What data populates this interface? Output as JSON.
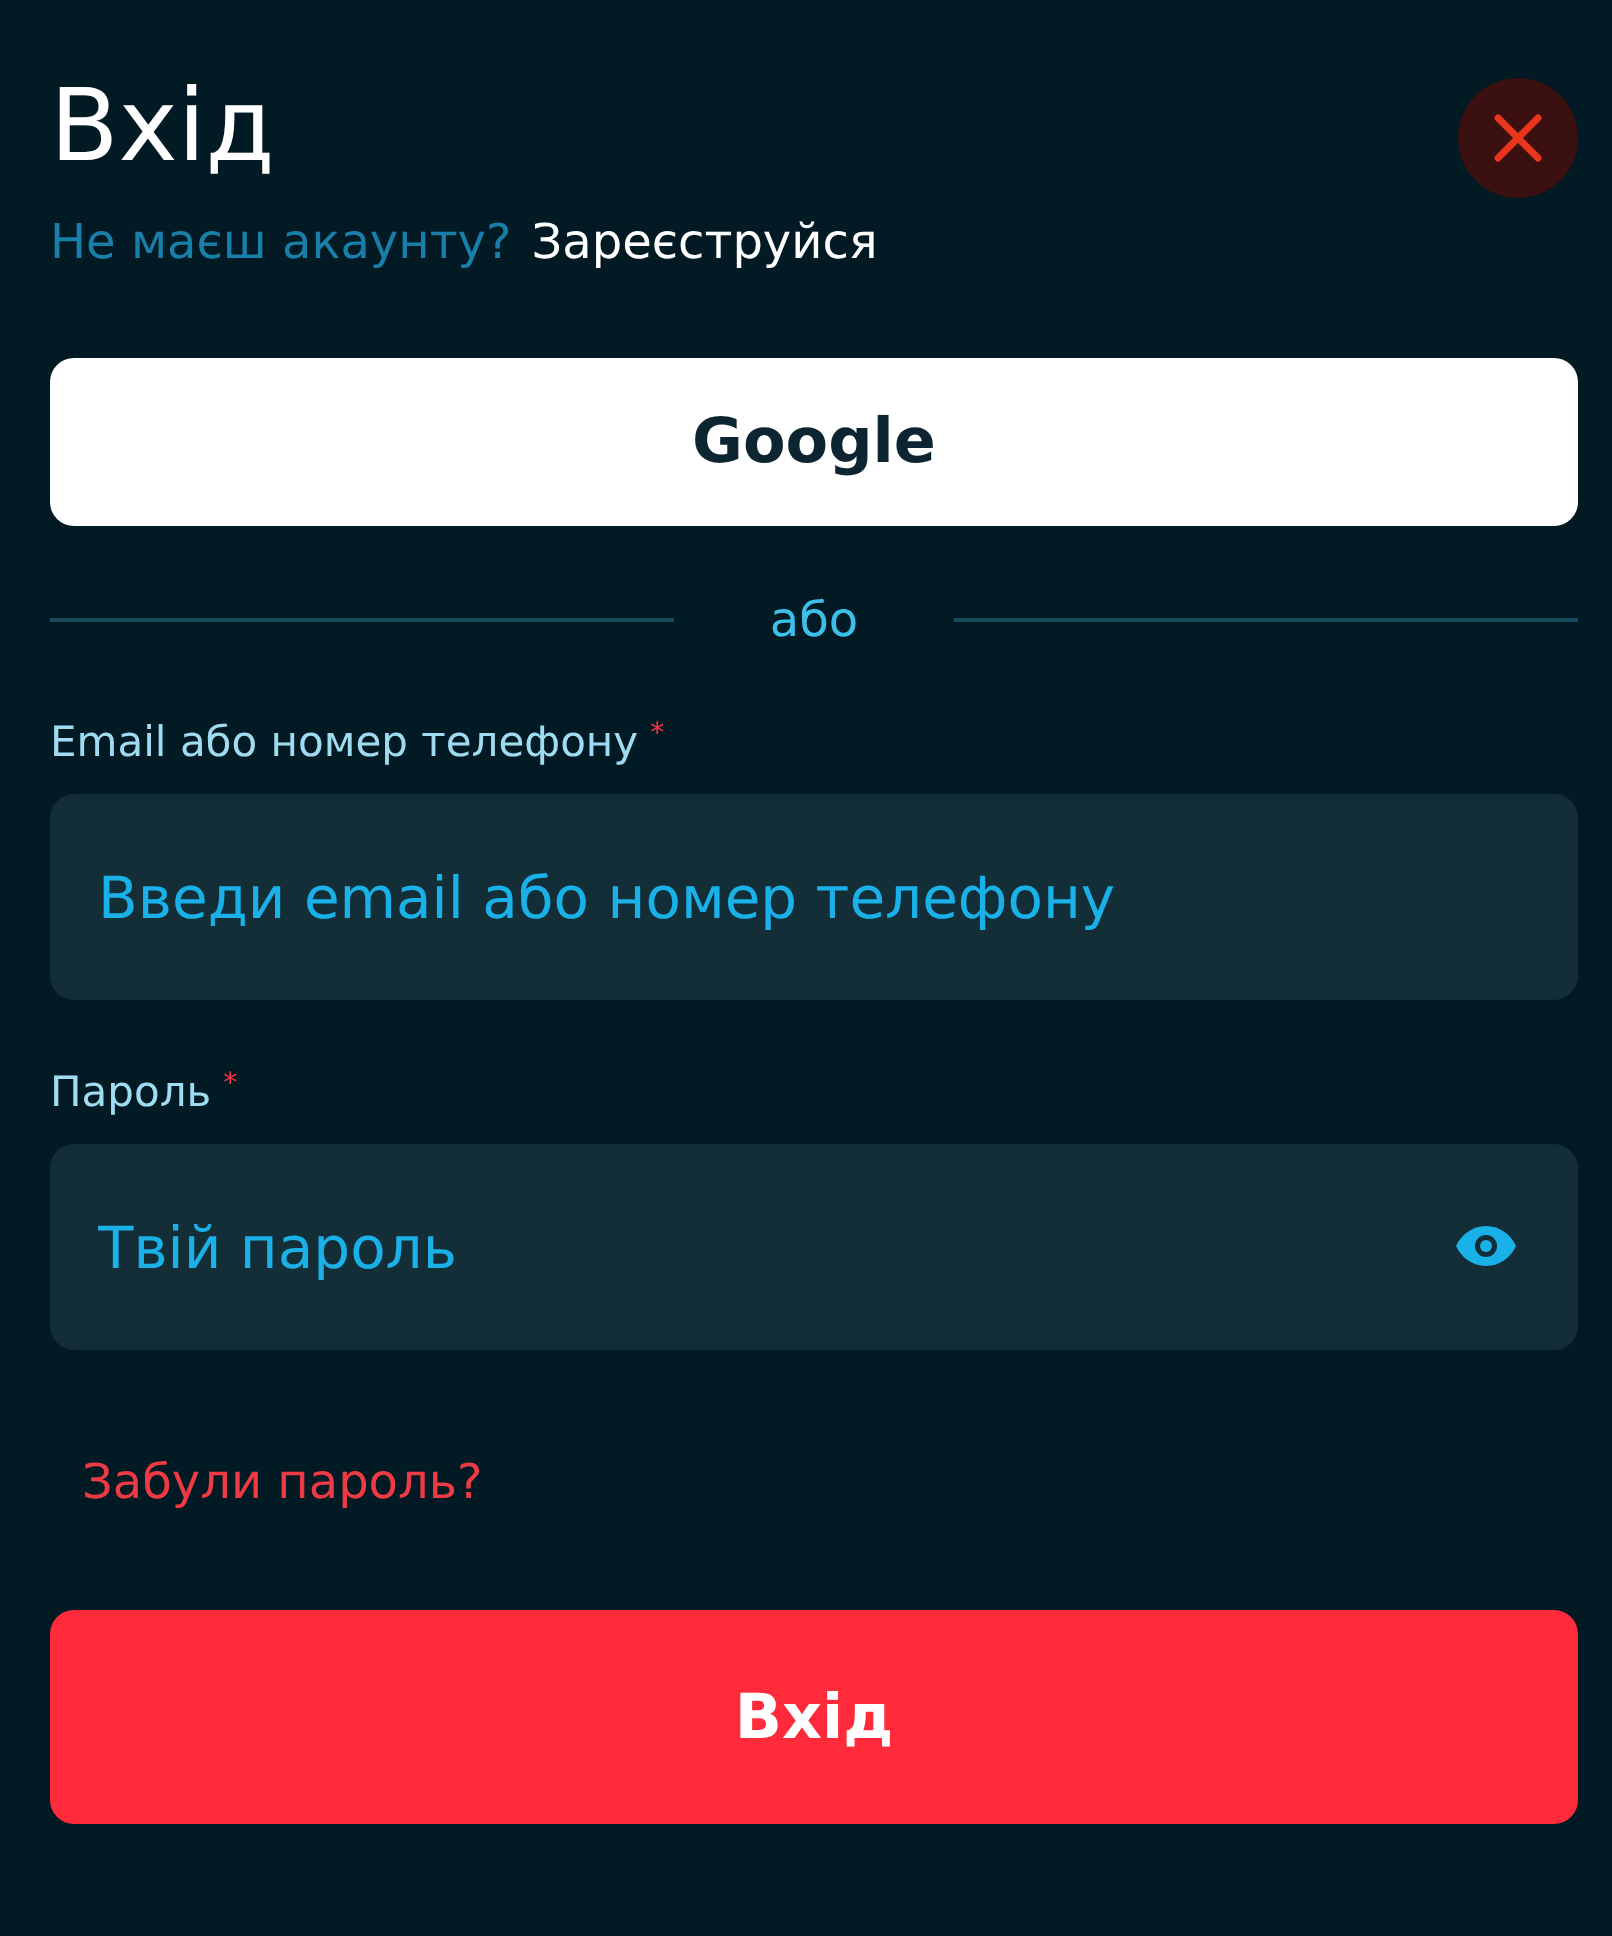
{
  "title": "Вхід",
  "signup": {
    "prompt": "Не маєш акаунту?",
    "link": "Зареєструйся"
  },
  "google_button": "Google",
  "divider": "або",
  "fields": [
    {
      "label": "Email або номер телефону",
      "required_mark": "*",
      "placeholder": "Введи email або номер телефону",
      "kind": "text"
    },
    {
      "label": "Пароль",
      "required_mark": "*",
      "placeholder": "Твій пароль",
      "kind": "password"
    }
  ],
  "forgot_link": "Забули пароль?",
  "submit_button": "Вхід"
}
